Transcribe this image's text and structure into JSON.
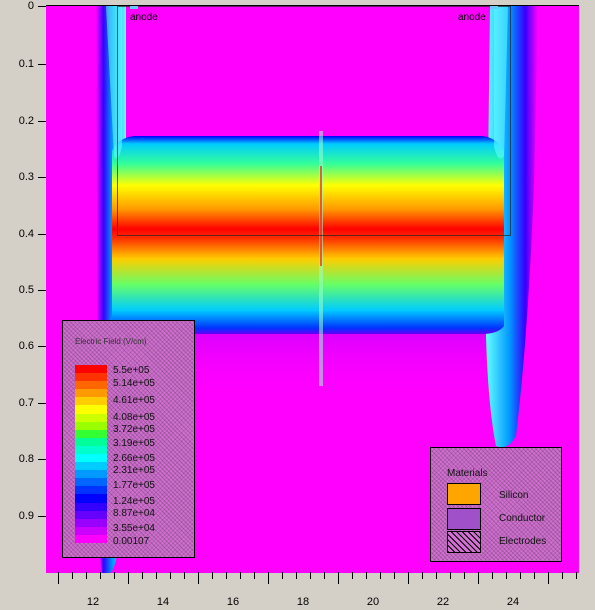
{
  "plot": {
    "anode_labels": [
      "anode",
      "anode"
    ],
    "y_ticks": [
      "0",
      "0.1",
      "0.2",
      "0.3",
      "0.4",
      "0.5",
      "0.6",
      "0.7",
      "0.8",
      "0.9"
    ],
    "x_ticks": [
      "12",
      "14",
      "16",
      "18",
      "20",
      "22",
      "24"
    ]
  },
  "field_legend": {
    "title": "Electric Field (V/cm)",
    "levels": [
      "5.5e+05",
      "5.14e+05",
      "4.61e+05",
      "4.08e+05",
      "3.72e+05",
      "3.19e+05",
      "2.66e+05",
      "2.31e+05",
      "1.77e+05",
      "1.24e+05",
      "8.87e+04",
      "3.55e+04",
      "0.00107"
    ],
    "colors": [
      "#ff0000",
      "#ff3300",
      "#ff6600",
      "#ff9900",
      "#ffcc00",
      "#ffff00",
      "#ccff00",
      "#99ff00",
      "#33ff33",
      "#00ff99",
      "#00ffcc",
      "#00ffff",
      "#00ccff",
      "#0099ff",
      "#0066ff",
      "#0033ff",
      "#0000ff",
      "#3300ff",
      "#6600ff",
      "#9900ff",
      "#cc00ff",
      "#ff00ff"
    ]
  },
  "materials_legend": {
    "title": "Materials",
    "items": [
      {
        "label": "Silicon",
        "color": "#ffa500"
      },
      {
        "label": "Conductor",
        "color": "#a050c8"
      },
      {
        "label": "Electrodes",
        "color": "#d070d0"
      }
    ]
  }
}
